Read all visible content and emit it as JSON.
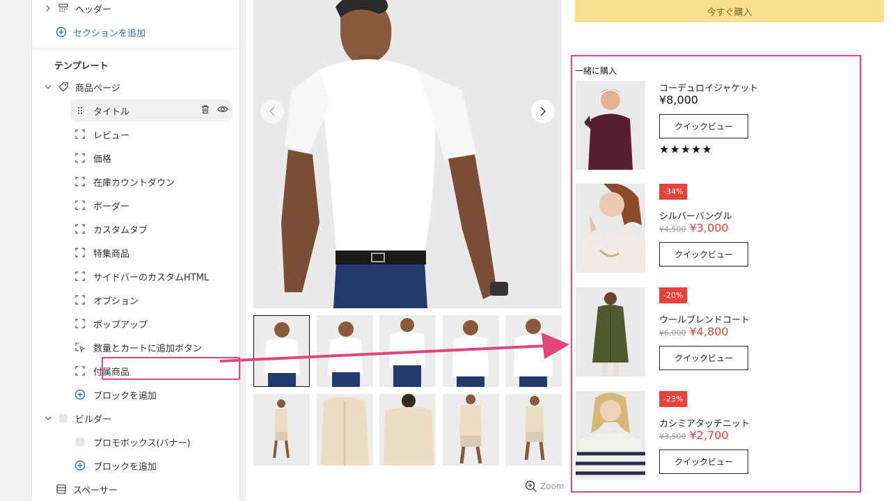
{
  "sidebar": {
    "header_item": "ヘッダー",
    "add_section": "セクションを追加",
    "template_title": "テンプレート",
    "product_page": "商品ページ",
    "blocks": [
      "タイトル",
      "レビュー",
      "価格",
      "在庫カウントダウン",
      "ボーダー",
      "カスタムタブ",
      "特集商品",
      "サイドバーのカスタムHTML",
      "オプション",
      "ポップアップ",
      "数量とカートに追加ボタン",
      "付属商品"
    ],
    "add_block": "ブロックを追加",
    "builder": "ビルダー",
    "promo_box": "プロモボックス(バナー)",
    "add_block_2": "ブロックを追加",
    "spacer": "スペーサー"
  },
  "preview": {
    "buy_now": "今すぐ購入",
    "zoom": "Zoom",
    "together_title": "一緒に購入",
    "quick_view": "クイックビュー",
    "products": [
      {
        "name": "コーデュロイジャケット",
        "price": "¥8,000",
        "rating": "★★★★★"
      },
      {
        "name": "シルバーバングル",
        "badge": "-34%",
        "old_price": "¥4,500",
        "price": "¥3,000"
      },
      {
        "name": "ウールブレンドコート",
        "badge": "-20%",
        "old_price": "¥6,000",
        "price": "¥4,800"
      },
      {
        "name": "カシミアタッチニット",
        "badge": "-23%",
        "old_price": "¥3,500",
        "price": "¥2,700"
      }
    ]
  },
  "colors": {
    "highlight": "#e0457b",
    "link": "#2c6ecb",
    "buy_button": "#f7e08c",
    "sale": "#e8403a"
  }
}
